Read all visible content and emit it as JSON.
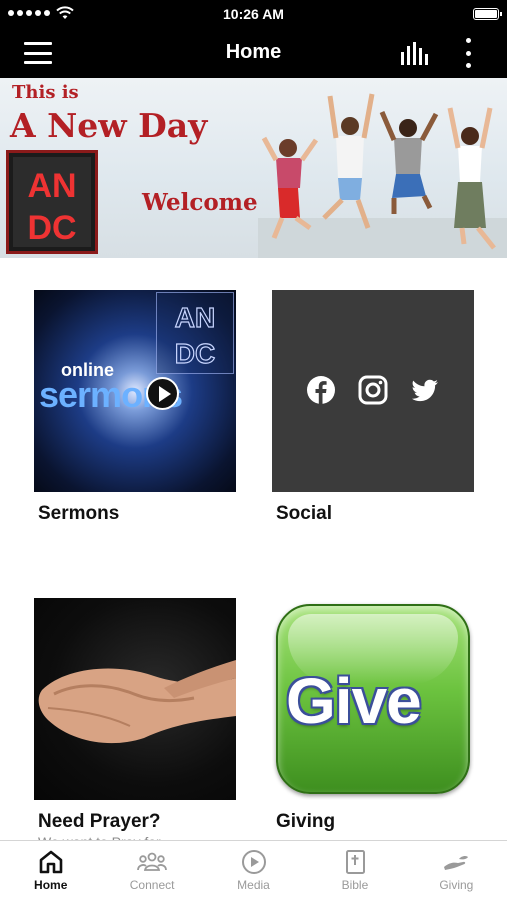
{
  "status_bar": {
    "time": "10:26 AM"
  },
  "app_bar": {
    "title": "Home"
  },
  "banner": {
    "line1": "This is",
    "line2": "A New Day",
    "logo_text": [
      "AN",
      "DC"
    ],
    "welcome": "Welcome"
  },
  "tiles": [
    {
      "label": "Sermons",
      "image_text_1": "online",
      "image_text_2": "sermons",
      "image_logo": [
        "AN",
        "DC"
      ]
    },
    {
      "label": "Social",
      "icons": [
        "facebook-icon",
        "instagram-icon",
        "twitter-icon"
      ]
    },
    {
      "label": "Need Prayer?",
      "subtext": "We want to Pray for..."
    },
    {
      "label": "Giving",
      "image_text": "Give"
    }
  ],
  "tab_bar": {
    "items": [
      {
        "label": "Home",
        "icon": "home-icon",
        "active": true
      },
      {
        "label": "Connect",
        "icon": "people-icon",
        "active": false
      },
      {
        "label": "Media",
        "icon": "play-circle-icon",
        "active": false
      },
      {
        "label": "Bible",
        "icon": "bible-icon",
        "active": false
      },
      {
        "label": "Giving",
        "icon": "giving-hand-icon",
        "active": false
      }
    ]
  },
  "colors": {
    "bar_background": "#000000",
    "banner_red": "#b32025",
    "social_tile": "#3b3b3b",
    "give_green": "#6cc33f",
    "tab_active": "#111111",
    "tab_inactive": "#9a9a9a"
  }
}
